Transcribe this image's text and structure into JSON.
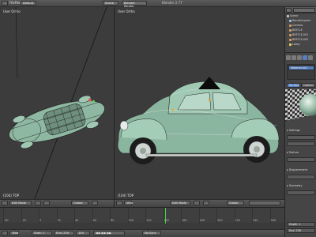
{
  "app": {
    "name": "Blender"
  },
  "topbar": {
    "menu": [
      "File",
      "Render",
      "Window",
      "Help"
    ],
    "layout": "Default",
    "scene": "Scene",
    "engine": "Blender Render",
    "title": "Blender 2.77"
  },
  "left_viewport": {
    "label": "User Ortho",
    "foot_label": "(104) TOP",
    "header": {
      "view": "View",
      "select": "Select",
      "add": "Add",
      "object": "Object",
      "mode": "Edit Mode",
      "pivot": "Global"
    }
  },
  "main_viewport": {
    "label": "User Ortho",
    "foot_label": "(104) TOP",
    "header": {
      "view": "View",
      "select": "Select",
      "add": "Add",
      "object": "Object",
      "mode": "Edit Mode",
      "pivot": "Global"
    }
  },
  "outliner": {
    "items": [
      {
        "label": "Scene",
        "color": "#c8c8c8"
      },
      {
        "label": "RenderLayers",
        "color": "#9ec3e6"
      },
      {
        "label": "Camera",
        "color": "#d89b58"
      },
      {
        "label": "BEETLE",
        "color": "#e0a060"
      },
      {
        "label": "BEETLE.001",
        "color": "#e0a060"
      },
      {
        "label": "BEETLE.002",
        "color": "#e0a060"
      },
      {
        "label": "Lamp",
        "color": "#f0d060"
      }
    ]
  },
  "properties": {
    "material_slot": "Material.001",
    "tabs": [
      "Surface",
      "Options"
    ],
    "section_settings": "Settings",
    "section_texture": "Texture",
    "section_displacement": "Displacement",
    "section_geometry": "Geometry",
    "field_depth": "Depth: 1",
    "field_start": "Start: 1",
    "field_end": "End: 250"
  },
  "timeline": {
    "ticks": [
      "-40",
      "-20",
      "0",
      "20",
      "40",
      "60",
      "80",
      "100",
      "120",
      "140",
      "160",
      "180",
      "200",
      "220",
      "240",
      "260"
    ],
    "header": {
      "view": "View",
      "marker": "Marker",
      "frame": "Frame",
      "playback": "Playback",
      "start": "Start: 1",
      "end": "End: 250",
      "current": "104",
      "sync": "No Sync"
    }
  },
  "colors": {
    "car_body": "#8ab59f",
    "car_light": "#b9dcc9",
    "wire": "#222222",
    "select": "#ff9c2a",
    "active_tab": "#5680c2"
  }
}
